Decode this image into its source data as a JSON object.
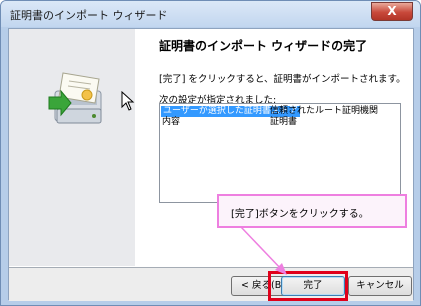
{
  "window": {
    "title": "証明書のインポート ウィザード",
    "close_glyph": "X"
  },
  "wizard": {
    "heading": "証明書のインポート ウィザードの完了",
    "intro": "[完了] をクリックすると、証明書がインポートされます。",
    "settings_label": "次の設定が指定されました:",
    "settings": [
      {
        "key": "ユーザーが選択した証明書ストア",
        "value": "信頼されたルート証明機関"
      },
      {
        "key": "内容",
        "value": "証明書"
      }
    ]
  },
  "buttons": {
    "back": "< 戻る(B)",
    "finish": "完了",
    "cancel": "キャンセル"
  },
  "callout": {
    "text": "[完了]ボタンをクリックする。"
  },
  "colors": {
    "highlight": "#e0001a",
    "callout_border": "#ee7fe0",
    "selection": "#3399ff"
  }
}
